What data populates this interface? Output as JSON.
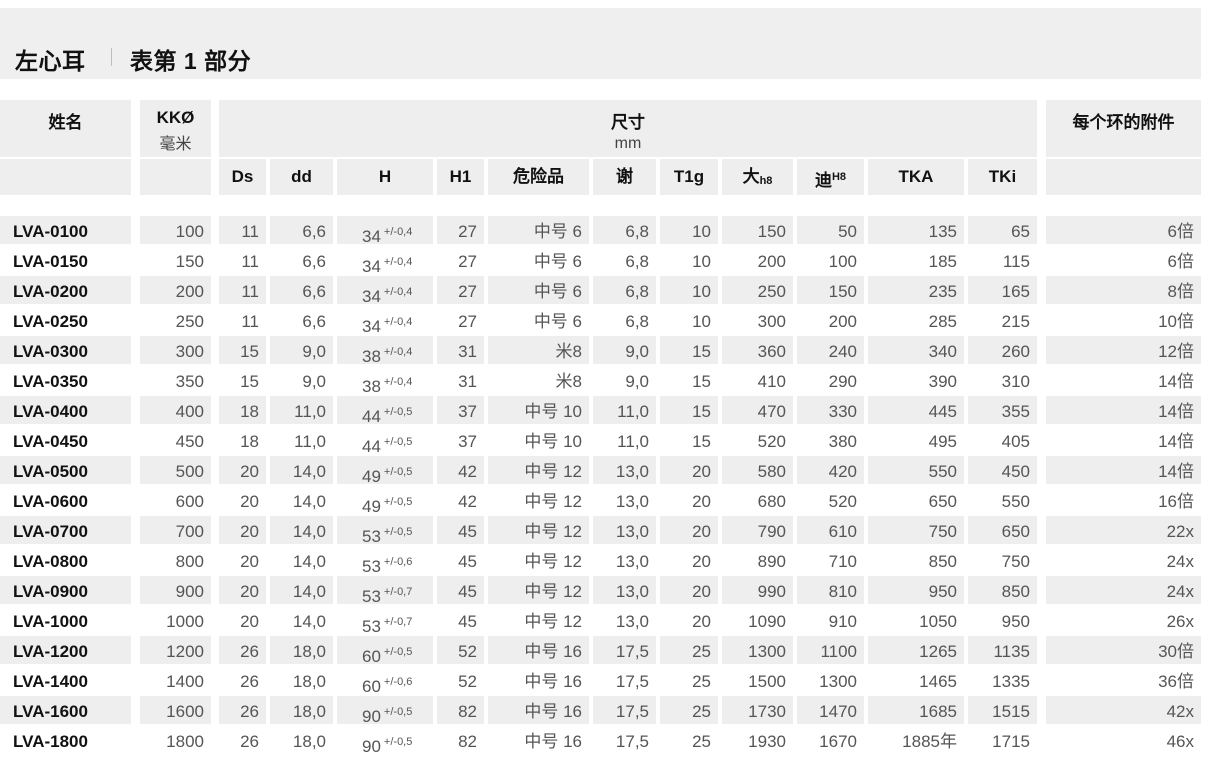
{
  "title": {
    "main": "左心耳",
    "sub": "表第 1 部分"
  },
  "header": {
    "name": "姓名",
    "kk_label": "KKØ",
    "kk_unit": "毫米",
    "dims_label": "尺寸",
    "dims_unit": "mm",
    "accessory": "每个环的附件",
    "sub": {
      "ds": "Ds",
      "dd": "dd",
      "h": "H",
      "h1": "H1",
      "danger": "危险品",
      "xie": "谢",
      "t1g": "T1g",
      "da": "大",
      "da_sub": "h8",
      "di": "迪",
      "di_sup": "H8",
      "tka": "TKA",
      "tki": "TKi"
    }
  },
  "rows": [
    {
      "name": "LVA-0100",
      "kk": "100",
      "ds": "11",
      "dd": "6,6",
      "h": "34",
      "tol": "+/-0,4",
      "h1": "27",
      "danger": "中号 6",
      "xie": "6,8",
      "t1g": "10",
      "da": "150",
      "di": "50",
      "tka": "135",
      "tki": "65",
      "acc": "6倍"
    },
    {
      "name": "LVA-0150",
      "kk": "150",
      "ds": "11",
      "dd": "6,6",
      "h": "34",
      "tol": "+/-0,4",
      "h1": "27",
      "danger": "中号 6",
      "xie": "6,8",
      "t1g": "10",
      "da": "200",
      "di": "100",
      "tka": "185",
      "tki": "115",
      "acc": "6倍"
    },
    {
      "name": "LVA-0200",
      "kk": "200",
      "ds": "11",
      "dd": "6,6",
      "h": "34",
      "tol": "+/-0,4",
      "h1": "27",
      "danger": "中号 6",
      "xie": "6,8",
      "t1g": "10",
      "da": "250",
      "di": "150",
      "tka": "235",
      "tki": "165",
      "acc": "8倍"
    },
    {
      "name": "LVA-0250",
      "kk": "250",
      "ds": "11",
      "dd": "6,6",
      "h": "34",
      "tol": "+/-0,4",
      "h1": "27",
      "danger": "中号 6",
      "xie": "6,8",
      "t1g": "10",
      "da": "300",
      "di": "200",
      "tka": "285",
      "tki": "215",
      "acc": "10倍"
    },
    {
      "name": "LVA-0300",
      "kk": "300",
      "ds": "15",
      "dd": "9,0",
      "h": "38",
      "tol": "+/-0,4",
      "h1": "31",
      "danger": "米8",
      "xie": "9,0",
      "t1g": "15",
      "da": "360",
      "di": "240",
      "tka": "340",
      "tki": "260",
      "acc": "12倍"
    },
    {
      "name": "LVA-0350",
      "kk": "350",
      "ds": "15",
      "dd": "9,0",
      "h": "38",
      "tol": "+/-0,4",
      "h1": "31",
      "danger": "米8",
      "xie": "9,0",
      "t1g": "15",
      "da": "410",
      "di": "290",
      "tka": "390",
      "tki": "310",
      "acc": "14倍"
    },
    {
      "name": "LVA-0400",
      "kk": "400",
      "ds": "18",
      "dd": "11,0",
      "h": "44",
      "tol": "+/-0,5",
      "h1": "37",
      "danger": "中号 10",
      "xie": "11,0",
      "t1g": "15",
      "da": "470",
      "di": "330",
      "tka": "445",
      "tki": "355",
      "acc": "14倍"
    },
    {
      "name": "LVA-0450",
      "kk": "450",
      "ds": "18",
      "dd": "11,0",
      "h": "44",
      "tol": "+/-0,5",
      "h1": "37",
      "danger": "中号 10",
      "xie": "11,0",
      "t1g": "15",
      "da": "520",
      "di": "380",
      "tka": "495",
      "tki": "405",
      "acc": "14倍"
    },
    {
      "name": "LVA-0500",
      "kk": "500",
      "ds": "20",
      "dd": "14,0",
      "h": "49",
      "tol": "+/-0,5",
      "h1": "42",
      "danger": "中号 12",
      "xie": "13,0",
      "t1g": "20",
      "da": "580",
      "di": "420",
      "tka": "550",
      "tki": "450",
      "acc": "14倍"
    },
    {
      "name": "LVA-0600",
      "kk": "600",
      "ds": "20",
      "dd": "14,0",
      "h": "49",
      "tol": "+/-0,5",
      "h1": "42",
      "danger": "中号 12",
      "xie": "13,0",
      "t1g": "20",
      "da": "680",
      "di": "520",
      "tka": "650",
      "tki": "550",
      "acc": "16倍"
    },
    {
      "name": "LVA-0700",
      "kk": "700",
      "ds": "20",
      "dd": "14,0",
      "h": "53",
      "tol": "+/-0,5",
      "h1": "45",
      "danger": "中号 12",
      "xie": "13,0",
      "t1g": "20",
      "da": "790",
      "di": "610",
      "tka": "750",
      "tki": "650",
      "acc": "22x"
    },
    {
      "name": "LVA-0800",
      "kk": "800",
      "ds": "20",
      "dd": "14,0",
      "h": "53",
      "tol": "+/-0,6",
      "h1": "45",
      "danger": "中号 12",
      "xie": "13,0",
      "t1g": "20",
      "da": "890",
      "di": "710",
      "tka": "850",
      "tki": "750",
      "acc": "24x"
    },
    {
      "name": "LVA-0900",
      "kk": "900",
      "ds": "20",
      "dd": "14,0",
      "h": "53",
      "tol": "+/-0,7",
      "h1": "45",
      "danger": "中号 12",
      "xie": "13,0",
      "t1g": "20",
      "da": "990",
      "di": "810",
      "tka": "950",
      "tki": "850",
      "acc": "24x"
    },
    {
      "name": "LVA-1000",
      "kk": "1000",
      "ds": "20",
      "dd": "14,0",
      "h": "53",
      "tol": "+/-0,7",
      "h1": "45",
      "danger": "中号 12",
      "xie": "13,0",
      "t1g": "20",
      "da": "1090",
      "di": "910",
      "tka": "1050",
      "tki": "950",
      "acc": "26x"
    },
    {
      "name": "LVA-1200",
      "kk": "1200",
      "ds": "26",
      "dd": "18,0",
      "h": "60",
      "tol": "+/-0,5",
      "h1": "52",
      "danger": "中号 16",
      "xie": "17,5",
      "t1g": "25",
      "da": "1300",
      "di": "1100",
      "tka": "1265",
      "tki": "1135",
      "acc": "30倍"
    },
    {
      "name": "LVA-1400",
      "kk": "1400",
      "ds": "26",
      "dd": "18,0",
      "h": "60",
      "tol": "+/-0,6",
      "h1": "52",
      "danger": "中号 16",
      "xie": "17,5",
      "t1g": "25",
      "da": "1500",
      "di": "1300",
      "tka": "1465",
      "tki": "1335",
      "acc": "36倍"
    },
    {
      "name": "LVA-1600",
      "kk": "1600",
      "ds": "26",
      "dd": "18,0",
      "h": "90",
      "tol": "+/-0,5",
      "h1": "82",
      "danger": "中号 16",
      "xie": "17,5",
      "t1g": "25",
      "da": "1730",
      "di": "1470",
      "tka": "1685",
      "tki": "1515",
      "acc": "42x"
    },
    {
      "name": "LVA-1800",
      "kk": "1800",
      "ds": "26",
      "dd": "18,0",
      "h": "90",
      "tol": "+/-0,5",
      "h1": "82",
      "danger": "中号 16",
      "xie": "17,5",
      "t1g": "25",
      "da": "1930",
      "di": "1670",
      "tka": "1885年",
      "tki": "1715",
      "acc": "46x"
    }
  ]
}
